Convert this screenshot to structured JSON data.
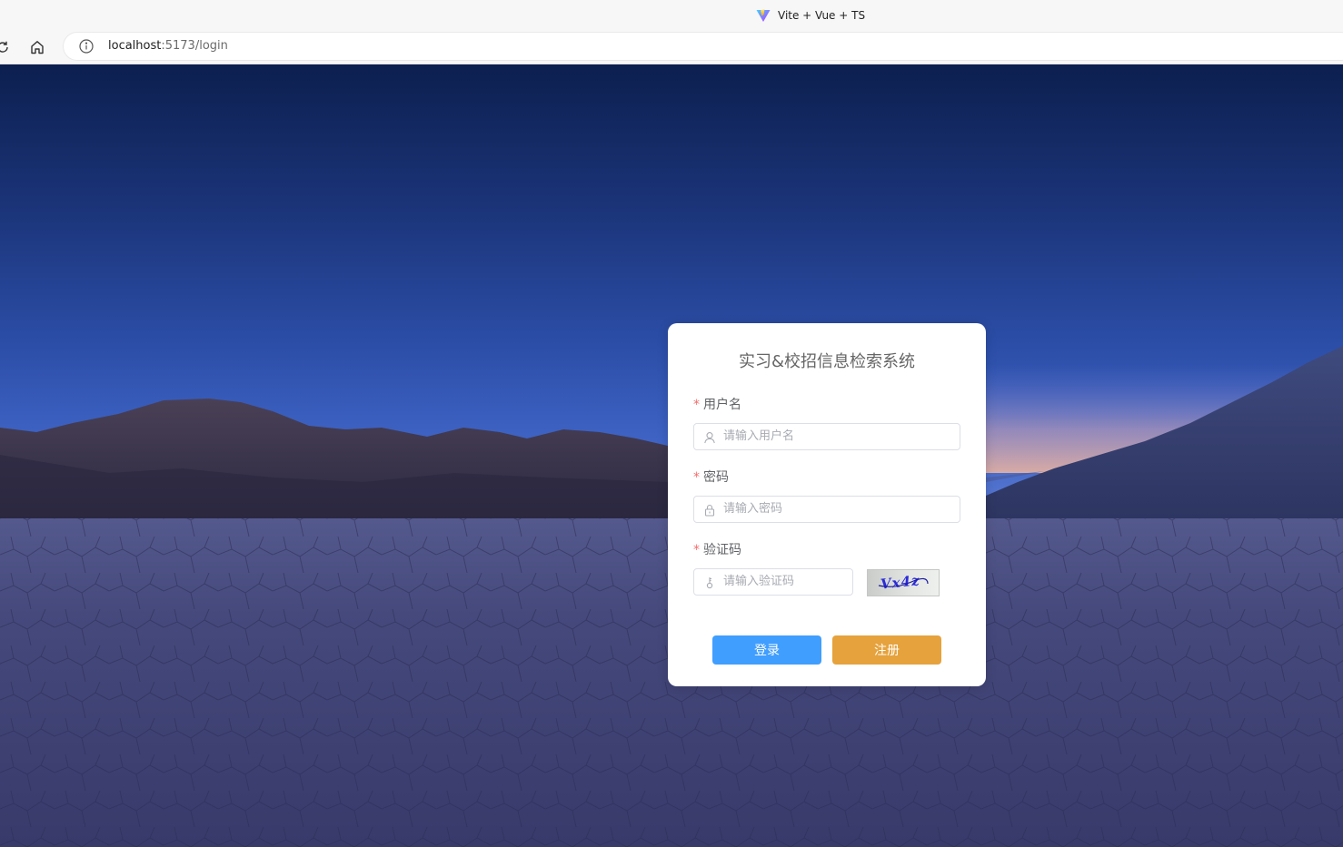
{
  "browser": {
    "tab_title": "Vite + Vue + TS",
    "url_host": "localhost",
    "url_path": ":5173/login"
  },
  "login": {
    "title": "实习&校招信息检索系统",
    "required_mark": "*",
    "username_label": "用户名",
    "username_placeholder": "请输入用户名",
    "password_label": "密码",
    "password_placeholder": "请输入密码",
    "captcha_label": "验证码",
    "captcha_placeholder": "请输入验证码",
    "captcha_text": "Vx4z",
    "login_button": "登录",
    "register_button": "注册"
  },
  "icons": {
    "reload": "reload-icon",
    "home": "home-icon",
    "site_info": "info-icon",
    "user": "user-icon",
    "lock": "lock-icon",
    "key": "key-icon"
  },
  "colors": {
    "primary": "#409eff",
    "warning": "#e6a23c",
    "required": "#f56c6c"
  }
}
